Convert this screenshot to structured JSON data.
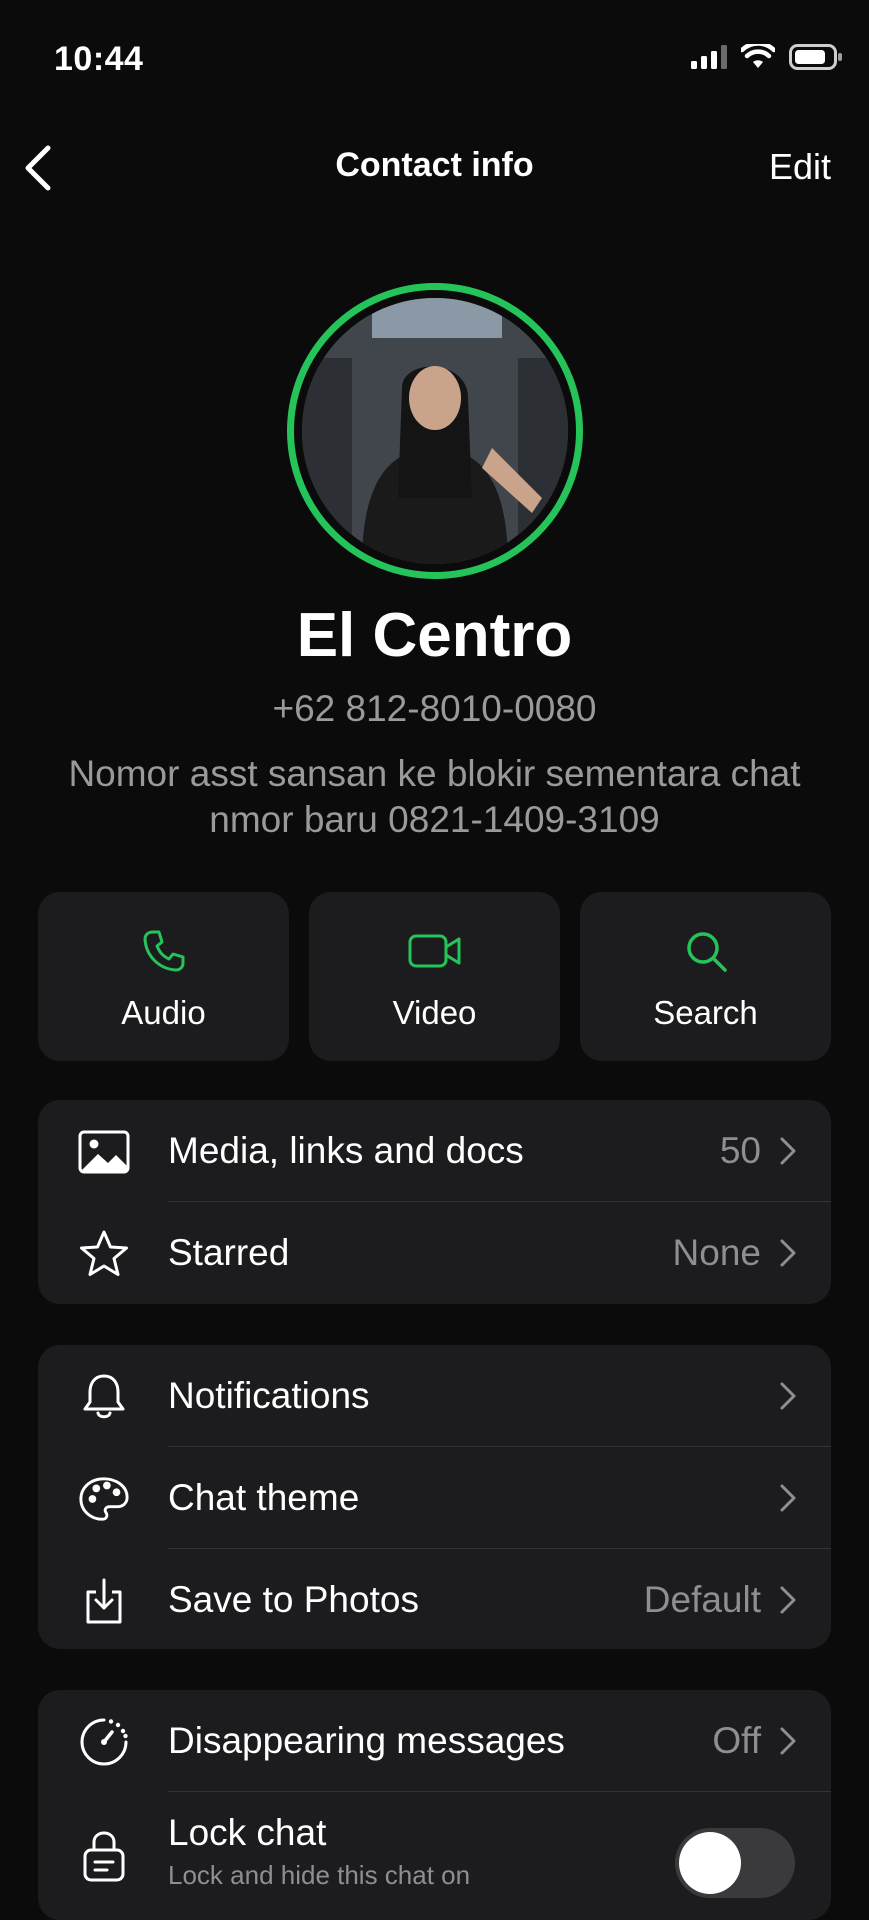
{
  "status_bar": {
    "time": "10:44"
  },
  "header": {
    "title": "Contact info",
    "edit_label": "Edit"
  },
  "contact": {
    "name": "El Centro",
    "phone": "+62 812-8010-0080",
    "about": "Nomor asst sansan ke blokir sementara chat nmor baru 0821-1409-3109"
  },
  "actions": [
    {
      "label": "Audio",
      "icon": "phone-icon"
    },
    {
      "label": "Video",
      "icon": "video-icon"
    },
    {
      "label": "Search",
      "icon": "search-icon"
    }
  ],
  "group1": [
    {
      "label": "Media, links and docs",
      "value": "50",
      "icon": "image-icon"
    },
    {
      "label": "Starred",
      "value": "None",
      "icon": "star-icon"
    }
  ],
  "group2": [
    {
      "label": "Notifications",
      "value": "",
      "icon": "bell-icon"
    },
    {
      "label": "Chat theme",
      "value": "",
      "icon": "palette-icon"
    },
    {
      "label": "Save to Photos",
      "value": "Default",
      "icon": "download-icon"
    }
  ],
  "group3": [
    {
      "label": "Disappearing messages",
      "value": "Off",
      "icon": "timer-icon"
    },
    {
      "label": "Lock chat",
      "sublabel": "Lock and hide this chat on",
      "icon": "lock-icon",
      "toggle_on": false
    }
  ],
  "colors": {
    "accent": "#25c45a",
    "background": "#0b0b0b",
    "card": "#1c1c1e",
    "secondary_text": "#8e8e93"
  }
}
